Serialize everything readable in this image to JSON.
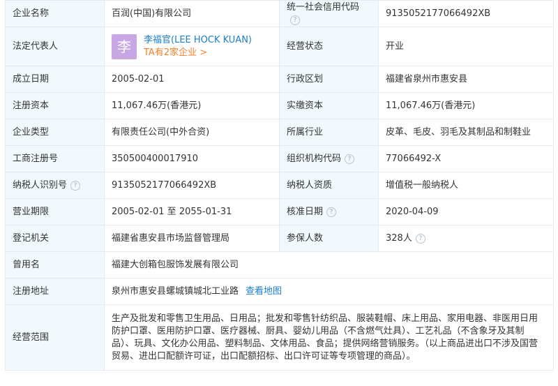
{
  "rows": [
    {
      "l1": "企业名称",
      "v1": "百润(中国)有限公司",
      "l2": "统一社会信用代码",
      "v2": "9135052177066492XB"
    },
    {
      "l1": "法定代表人",
      "rep_avatar": "李",
      "rep_name": "李福官(LEE HOCK KUAN)",
      "rep_link": "TA有2家企业 >",
      "l2": "经营状态",
      "v2": "开业"
    },
    {
      "l1": "成立日期",
      "v1": "2005-02-01",
      "l2": "行政区划",
      "v2": "福建省泉州市惠安县"
    },
    {
      "l1": "注册资本",
      "v1": "11,067.46万(香港元)",
      "l2": "实缴资本",
      "v2": "11,067.46万(香港元)"
    },
    {
      "l1": "企业类型",
      "v1": "有限责任公司(中外合资)",
      "l2": "所属行业",
      "v2": "皮革、毛皮、羽毛及其制品和制鞋业"
    },
    {
      "l1": "工商注册号",
      "v1": "350500400017910",
      "l2": "组织机构代码",
      "v2": "77066492-X"
    },
    {
      "l1": "纳税人识别号",
      "v1": "9135052177066492XB",
      "l2": "纳税人资质",
      "v2": "增值税一般纳税人"
    },
    {
      "l1": "营业期限",
      "v1": "2005-02-01 至 2055-01-31",
      "l2": "核准日期",
      "v2": "2020-04-09"
    },
    {
      "l1": "登记机关",
      "v1": "福建省惠安县市场监督管理局",
      "l2": "参保人数",
      "v2": "328人"
    },
    {
      "l1": "曾用名",
      "v1": "福建大创箱包服饰发展有限公司"
    },
    {
      "l1": "注册地址",
      "v1": "泉州市惠安县螺城镇城北工业路",
      "map_link": "查看地图"
    },
    {
      "l1": "经营范围",
      "v1": "生产及批发和零售卫生用品、日用品；批发和零售针纺织品、服装鞋帽、床上用品、家用电器、非医用日用防护口罩、医用防护口罩、医疗器械、厨具、婴幼儿用品（不含燃气灶具）、工艺礼品（不含象牙及其制品）、玩具、文化办公用品、塑料制品、文体用品、食品；提供网络营销服务。（以上商品进出口不涉及国营贸易、进出口配额许可证，出口配额招标、出口许可证等专项管理的商品）。"
    }
  ],
  "help_glyph": "?",
  "colors": {
    "label_bg": "#f2f9fc",
    "border": "#e4eaf2",
    "link": "#1a7ecf",
    "accent": "#f5802a",
    "avatar_bg": "#c9a7e4"
  }
}
